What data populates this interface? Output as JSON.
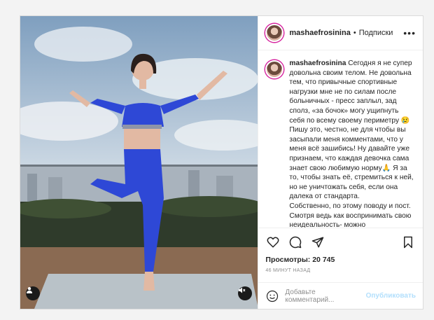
{
  "post": {
    "username": "mashaefrosinina",
    "separator": "•",
    "follow_label": "Подписки",
    "more": "•••",
    "caption": "Сегодня я не супер довольна своим телом. Не довольна тем, что привычные спортивные нагрузки мне не по силам после больничных - пресс заплыл, зад сполз, «за бочок» могу ущипнуть себя по всему своему периметру 😢\nПишу это, честно, не для чтобы вы засыпали меня комментами, что у меня всё зашибись! Ну давайте уже признаем, что каждая девочка сама знает свою любимую норму🙏 Я за то, чтобы знать её, стремиться к ней, но не уничтожать себя, если она далека от стандарта.\nСобственно, по этому поводу и пост. Смотря ведь как воспринимать свою неидеальность- можно",
    "views_label": "Просмотры:",
    "views_count": "20 745",
    "time_ago": "46 МИНУТ НАЗАД",
    "comment_placeholder": "Добавьте комментарий...",
    "publish_label": "Опубликовать"
  },
  "icons": {
    "like": "heart-icon",
    "comment": "comment-icon",
    "share": "share-icon",
    "save": "bookmark-icon",
    "emoji": "smiley-icon",
    "user": "user-icon",
    "mute": "mute-icon"
  }
}
